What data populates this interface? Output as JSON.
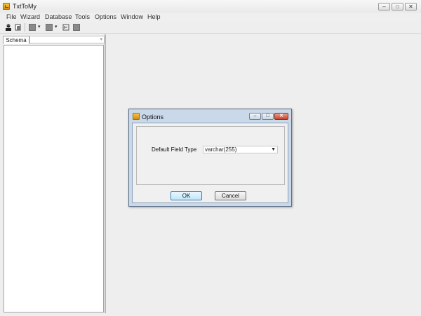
{
  "app": {
    "title": "TxtToMy"
  },
  "window_controls": {
    "minimize": "–",
    "maximize": "□",
    "close": "✕"
  },
  "menu": {
    "items": [
      "File",
      "Wizard",
      "Database",
      "Tools",
      "Options",
      "Window",
      "Help"
    ]
  },
  "toolbar": {
    "icons": [
      "connect-icon",
      "disconnect-icon",
      "gray-square-icon",
      "gray-square-icon",
      "tree-icon",
      "gray-square-icon"
    ],
    "dropdown_glyph": "▾"
  },
  "sidebar": {
    "tab_label": "Schema",
    "select_value": "",
    "select_arrow": "▾"
  },
  "dialog": {
    "title": "Options",
    "field_label": "Default Field Type",
    "field_value": "varchar(255)",
    "field_arrow": "▼",
    "ok_label": "OK",
    "cancel_label": "Cancel"
  },
  "colors": {
    "dialog_frame": "#c9d9ea",
    "accent_button": "#bee6fd",
    "icon_orange": "#e7a11e"
  }
}
